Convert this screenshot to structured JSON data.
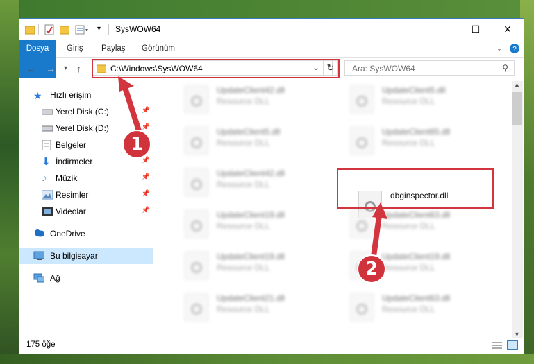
{
  "window": {
    "title": "SysWOW64",
    "minimize": "—",
    "maximize": "☐",
    "close": "✕"
  },
  "ribbon": {
    "tabs": [
      "Dosya",
      "Giriş",
      "Paylaş",
      "Görünüm"
    ]
  },
  "address": {
    "path": "C:\\Windows\\SysWOW64",
    "refresh": "↻",
    "dropdown": "⌄"
  },
  "search": {
    "placeholder": "Ara: SysWOW64"
  },
  "nav": {
    "items": [
      {
        "label": "Hızlı erişim"
      },
      {
        "label": "Yerel Disk (C:)"
      },
      {
        "label": "Yerel Disk (D:)"
      },
      {
        "label": "Belgeler"
      },
      {
        "label": "İndirmeler"
      },
      {
        "label": "Müzik"
      },
      {
        "label": "Resimler"
      },
      {
        "label": "Videolar"
      },
      {
        "label": "OneDrive"
      },
      {
        "label": "Bu bilgisayar"
      },
      {
        "label": "Ağ"
      }
    ]
  },
  "files": [
    {
      "name": "UpdateClient42.dll",
      "type": "Resource DLL"
    },
    {
      "name": "UpdateClient5.dll",
      "type": "Resource DLL"
    },
    {
      "name": "UpdateClient5.dll",
      "type": "Resource DLL"
    },
    {
      "name": "UpdateClient65.dll",
      "type": "Resource DLL"
    },
    {
      "name": "UpdateClient42.dll",
      "type": "Resource DLL"
    },
    {
      "name": "dbginspector.dll",
      "type": ""
    },
    {
      "name": "UpdateClient19.dll",
      "type": "Resource DLL"
    },
    {
      "name": "UpdateClient63.dll",
      "type": "Resource DLL"
    },
    {
      "name": "UpdateClient19.dll",
      "type": "Resource DLL"
    },
    {
      "name": "UpdateClient19.dll",
      "type": "Resource DLL"
    },
    {
      "name": "UpdateClient21.dll",
      "type": "Resource DLL"
    },
    {
      "name": "UpdateClient63.dll",
      "type": "Resource DLL"
    }
  ],
  "status": {
    "count": "175 öğe"
  },
  "annotations": {
    "step1": "1",
    "step2": "2",
    "color": "#d2353e"
  }
}
